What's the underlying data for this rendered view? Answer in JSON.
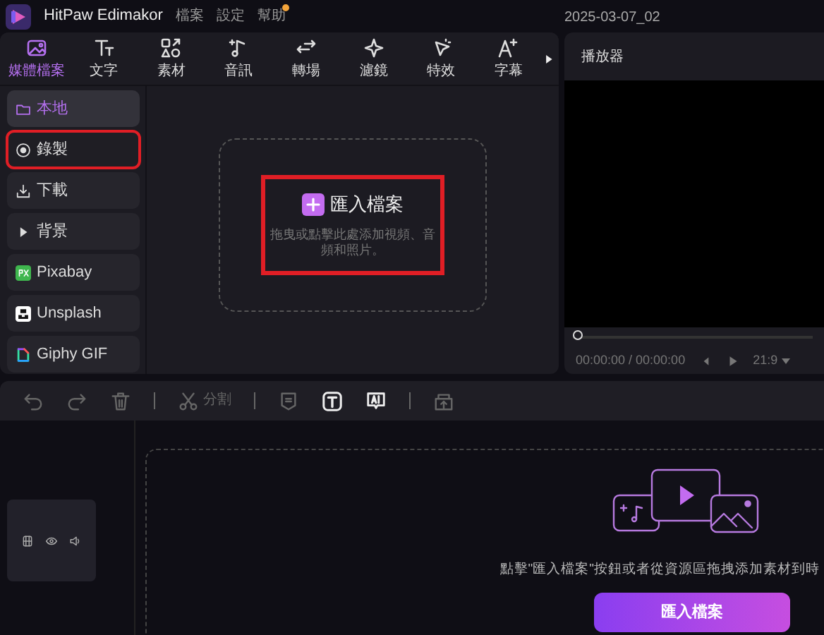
{
  "app": {
    "title": "HitPaw Edimakor",
    "menu": [
      {
        "label": "檔案",
        "badge": false
      },
      {
        "label": "設定",
        "badge": false
      },
      {
        "label": "幫助",
        "badge": true
      }
    ],
    "project": "2025-03-07_02"
  },
  "tabs": [
    {
      "label": "媒體檔案",
      "kind": "media",
      "selected": true
    },
    {
      "label": "文字",
      "kind": "text",
      "selected": false
    },
    {
      "label": "素材",
      "kind": "assets",
      "selected": false
    },
    {
      "label": "音訊",
      "kind": "audio",
      "selected": false
    },
    {
      "label": "轉場",
      "kind": "transition",
      "selected": false
    },
    {
      "label": "濾鏡",
      "kind": "filter",
      "selected": false
    },
    {
      "label": "特效",
      "kind": "effect",
      "selected": false
    },
    {
      "label": "字幕",
      "kind": "subtitle",
      "selected": false
    }
  ],
  "sidebar": {
    "items": [
      {
        "label": "本地",
        "kind": "folder",
        "selected": true,
        "highlighted": false
      },
      {
        "label": "錄製",
        "kind": "record",
        "selected": false,
        "highlighted": true
      },
      {
        "label": "下載",
        "kind": "download",
        "selected": false,
        "highlighted": false
      },
      {
        "label": "背景",
        "kind": "expand",
        "selected": false,
        "highlighted": false
      },
      {
        "label": "Pixabay",
        "kind": "pixabay",
        "selected": false,
        "highlighted": false
      },
      {
        "label": "Unsplash",
        "kind": "unsplash",
        "selected": false,
        "highlighted": false
      },
      {
        "label": "Giphy GIF",
        "kind": "giphy",
        "selected": false,
        "highlighted": false
      }
    ]
  },
  "import_area": {
    "button": "匯入檔案",
    "hint": "拖曳或點擊此處添加視頻、音頻和照片。",
    "highlighted": true
  },
  "player": {
    "title": "播放器",
    "time": "00:00:00 / 00:00:00",
    "ratio": "21:9",
    "level": 0
  },
  "timeline": {
    "toolbar": [
      {
        "kind": "undo",
        "disabled": true
      },
      {
        "kind": "redo",
        "disabled": true
      },
      {
        "kind": "delete",
        "disabled": true
      },
      {
        "kind": "separator"
      },
      {
        "kind": "split",
        "label": "分割",
        "disabled": true
      },
      {
        "kind": "separator"
      },
      {
        "kind": "marker",
        "disabled": true
      },
      {
        "kind": "text",
        "disabled": false
      },
      {
        "kind": "ai",
        "disabled": false
      },
      {
        "kind": "separator"
      },
      {
        "kind": "export",
        "disabled": true
      }
    ],
    "hint": "點擊\"匯入檔案\"按鈕或者從資源區拖拽添加素材到時",
    "button": "匯入檔案"
  }
}
